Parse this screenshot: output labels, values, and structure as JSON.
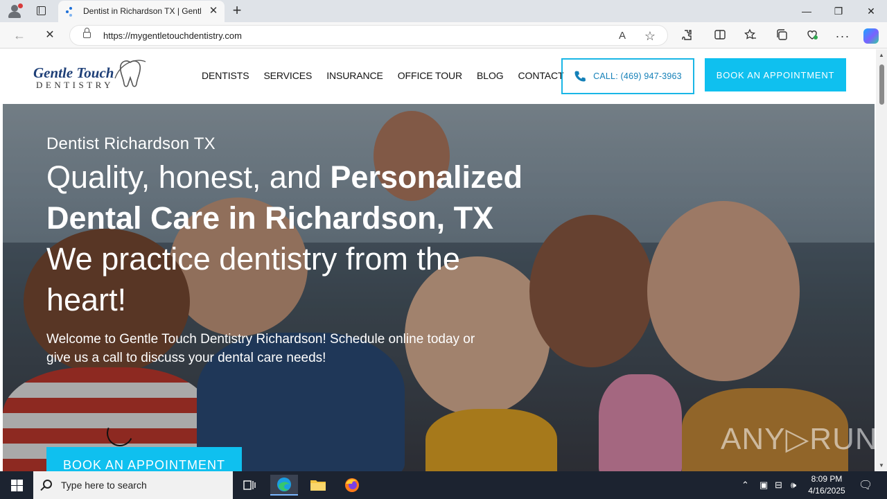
{
  "browser": {
    "tab_title": "Dentist in Richardson TX | Gentle Touch Dentistry",
    "url": "https://mygentletouchdentistry.com",
    "new_tab_symbol": "+",
    "minimize_symbol": "—",
    "restore_symbol": "❐",
    "close_symbol": "✕",
    "back_symbol": "←",
    "reload_symbol": "✕",
    "read_aloud_symbol": "A",
    "favorite_symbol": "☆"
  },
  "site": {
    "logo_script": "Gentle Touch",
    "logo_sub": "DENTISTRY",
    "nav": [
      "DENTISTS",
      "SERVICES",
      "INSURANCE",
      "OFFICE TOUR",
      "BLOG",
      "CONTACT"
    ],
    "call_label": "CALL: (469) 947-3963",
    "book_label": "BOOK AN APPOINTMENT",
    "accent_color": "#0fc0ef"
  },
  "hero": {
    "kicker": "Dentist Richardson TX",
    "headline_light": "Quality, honest, and ",
    "headline_bold": "Personalized Dental Care in Richardson, TX",
    "headline_tail": "We practice dentistry from the heart!",
    "intro": "Welcome to Gentle Touch Dentistry Richardson! Schedule online today or give us a call to discuss your dental care needs!",
    "cta": "BOOK AN APPOINTMENT",
    "watermark": "ANY▷RUN"
  },
  "taskbar": {
    "search_placeholder": "Type here to search",
    "time": "8:09 PM",
    "date": "4/16/2025"
  }
}
